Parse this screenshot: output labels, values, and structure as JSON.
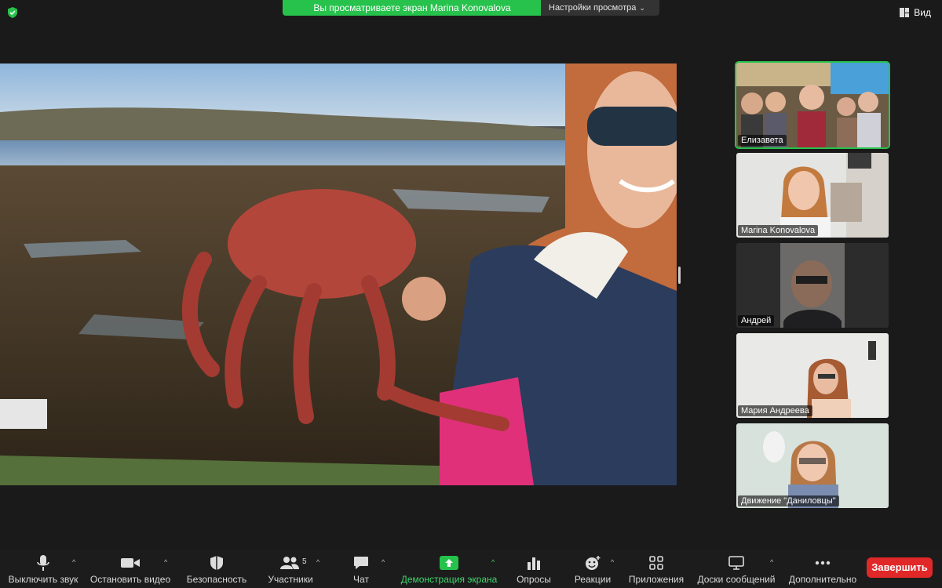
{
  "top": {
    "share_banner": "Вы просматриваете экран Marina Konovalova",
    "view_settings": "Настройки просмотра",
    "view_button": "Вид"
  },
  "participants": [
    {
      "name": "Елизавета",
      "active": true
    },
    {
      "name": "Marina Konovalova",
      "active": false
    },
    {
      "name": "Андрей",
      "active": false
    },
    {
      "name": "Мария Андреева",
      "active": false
    },
    {
      "name": "Движение \"Даниловцы\"",
      "active": false
    }
  ],
  "toolbar": {
    "mute": "Выключить звук",
    "stop_video": "Остановить видео",
    "security": "Безопасность",
    "participants": "Участники",
    "participants_count": "5",
    "chat": "Чат",
    "share_screen": "Демонстрация экрана",
    "polls": "Опросы",
    "reactions": "Реакции",
    "apps": "Приложения",
    "whiteboards": "Доски сообщений",
    "more": "Дополнительно",
    "end": "Завершить"
  },
  "colors": {
    "accent_green": "#27c24c",
    "end_red": "#e02828"
  }
}
